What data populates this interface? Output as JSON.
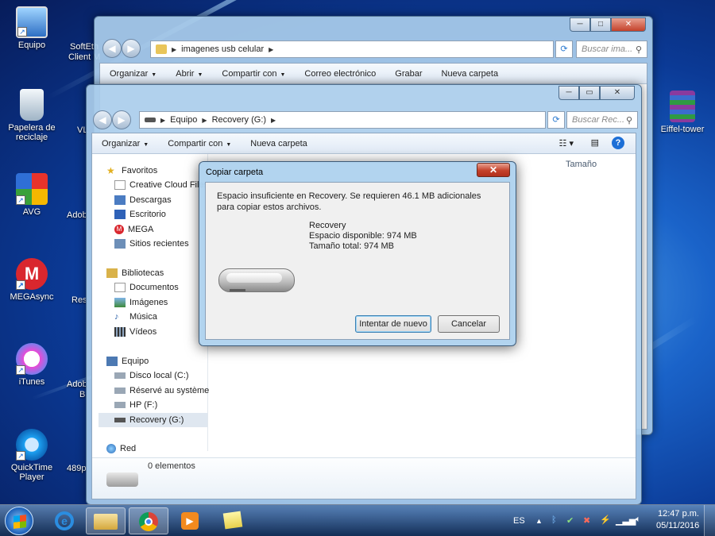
{
  "desktop": {
    "icons": [
      {
        "label": "Equipo"
      },
      {
        "label": "Papelera de reciclaje"
      },
      {
        "label": "AVG"
      },
      {
        "label": "MEGAsync"
      },
      {
        "label": "iTunes"
      },
      {
        "label": "QuickTime Player"
      },
      {
        "label": "Eiffel-tower"
      }
    ],
    "peek_labels": [
      "SoftEth",
      "Client M",
      "VL",
      "Adob",
      "Res",
      "Adob",
      "B",
      "489p"
    ]
  },
  "back_window": {
    "path": [
      "imagenes usb celular"
    ],
    "search_placeholder": "Buscar ima...",
    "toolbar": [
      "Organizar",
      "Abrir",
      "Compartir con",
      "Correo electrónico",
      "Grabar",
      "Nueva carpeta"
    ]
  },
  "front_window": {
    "path": [
      "Equipo",
      "Recovery (G:)"
    ],
    "search_placeholder": "Buscar Rec...",
    "toolbar": [
      "Organizar",
      "Compartir con",
      "Nueva carpeta"
    ],
    "column_header": "Tamaño",
    "sidebar": {
      "favorites_header": "Favoritos",
      "favorites": [
        "Creative Cloud Files",
        "Descargas",
        "Escritorio",
        "MEGA",
        "Sitios recientes"
      ],
      "libraries_header": "Bibliotecas",
      "libraries": [
        "Documentos",
        "Imágenes",
        "Música",
        "Vídeos"
      ],
      "computer_header": "Equipo",
      "computer": [
        "Disco local (C:)",
        "Réservé au système",
        "HP (F:)",
        "Recovery (G:)"
      ],
      "network": "Red"
    },
    "status": "0 elementos"
  },
  "dialog": {
    "title": "Copiar carpeta",
    "message": "Espacio insuficiente en Recovery. Se requieren 46.1 MB adicionales para copiar estos archivos.",
    "drive_name": "Recovery",
    "free_space": "Espacio disponible: 974 MB",
    "total_size": "Tamaño total: 974 MB",
    "retry_label": "Intentar de nuevo",
    "cancel_label": "Cancelar"
  },
  "taskbar": {
    "language": "ES",
    "time": "12:47 p.m.",
    "date": "05/11/2016"
  },
  "colors": {
    "accent": "#1d6fd6",
    "close_red": "#c4412a",
    "mega_red": "#d9272e"
  }
}
